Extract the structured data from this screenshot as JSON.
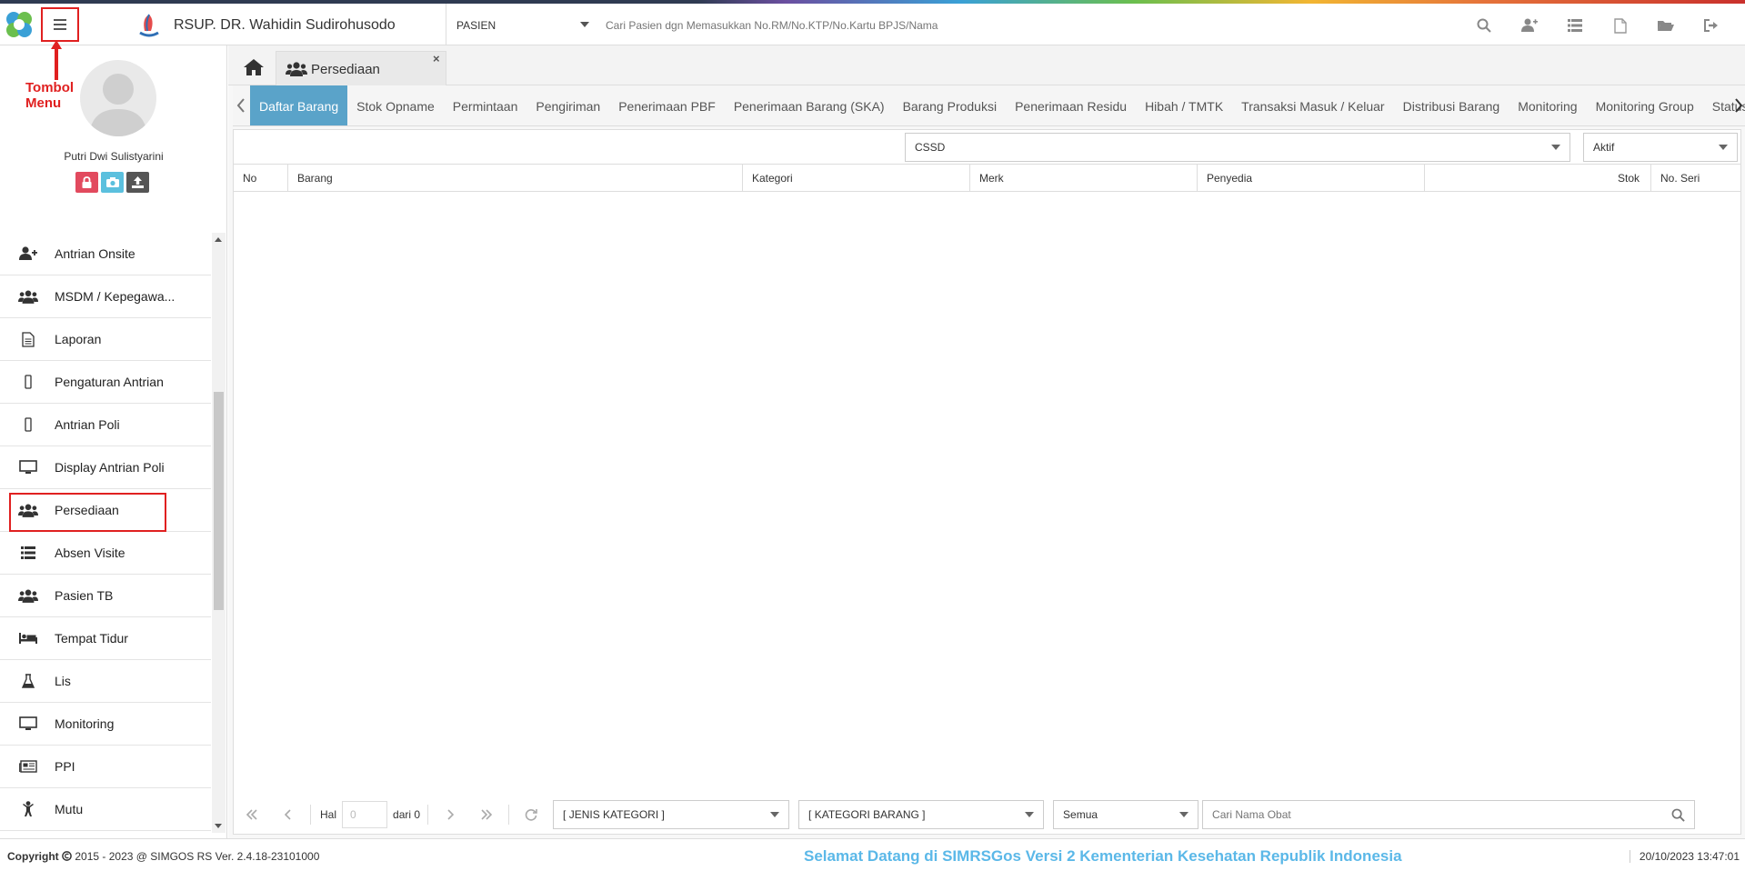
{
  "header": {
    "hospital_name": "RSUP. DR. Wahidin Sudirohusodo",
    "patient_select": "PASIEN",
    "search_placeholder": "Cari Pasien dgn Memasukkan No.RM/No.KTP/No.Kartu BPJS/Nama",
    "icons": [
      "search-icon",
      "user-plus-icon",
      "list-icon",
      "pdf-file-icon",
      "folder-open-icon",
      "sign-out-icon"
    ]
  },
  "annotation": {
    "tombol_line1": "Tombol",
    "tombol_line2": "Menu"
  },
  "sidebar": {
    "user_name": "Putri Dwi Sulistyarini",
    "items": [
      {
        "label": "Antrian Onsite",
        "icon": "user-plus-icon"
      },
      {
        "label": "MSDM / Kepegawa...",
        "icon": "users-icon"
      },
      {
        "label": "Laporan",
        "icon": "document-icon"
      },
      {
        "label": "Pengaturan Antrian",
        "icon": "mobile-icon"
      },
      {
        "label": "Antrian Poli",
        "icon": "mobile-icon"
      },
      {
        "label": "Display Antrian Poli",
        "icon": "monitor-icon"
      },
      {
        "label": "Persediaan",
        "icon": "users-icon"
      },
      {
        "label": "Absen Visite",
        "icon": "list-icon"
      },
      {
        "label": "Pasien TB",
        "icon": "users-icon"
      },
      {
        "label": "Tempat Tidur",
        "icon": "bed-icon"
      },
      {
        "label": "Lis",
        "icon": "flask-icon"
      },
      {
        "label": "Monitoring",
        "icon": "monitor-icon"
      },
      {
        "label": "PPI",
        "icon": "newspaper-icon"
      },
      {
        "label": "Mutu",
        "icon": "child-icon"
      }
    ]
  },
  "main": {
    "tab_label": "Persediaan",
    "tab_close": "×",
    "subtabs": [
      "Daftar Barang",
      "Stok Opname",
      "Permintaan",
      "Pengiriman",
      "Penerimaan PBF",
      "Penerimaan Barang (SKA)",
      "Barang Produksi",
      "Penerimaan Residu",
      "Hibah / TMTK",
      "Transaksi Masuk / Keluar",
      "Distribusi Barang",
      "Monitoring",
      "Monitoring Group",
      "Status Mu"
    ],
    "filter_ruangan": "CSSD",
    "filter_status": "Aktif",
    "columns": [
      "No",
      "Barang",
      "Kategori",
      "Merk",
      "Penyedia",
      "Stok",
      "No. Seri"
    ],
    "pager": {
      "hal_label": "Hal",
      "page_value": "0",
      "dari_label": "dari 0",
      "jenis_kategori": "[ JENIS KATEGORI ]",
      "kategori_barang": "[ KATEGORI BARANG ]",
      "semua": "Semua",
      "search_placeholder": "Cari Nama Obat"
    }
  },
  "footer": {
    "copyright_label": "Copyright",
    "copyright_text": "2015 - 2023 @ SIMGOS RS Ver. 2.4.18-23101000",
    "marquee": "Selamat Datang di SIMRSGos Versi 2 Kementerian Kesehatan Republik Indonesia",
    "datetime": "20/10/2023 13:47:01"
  }
}
